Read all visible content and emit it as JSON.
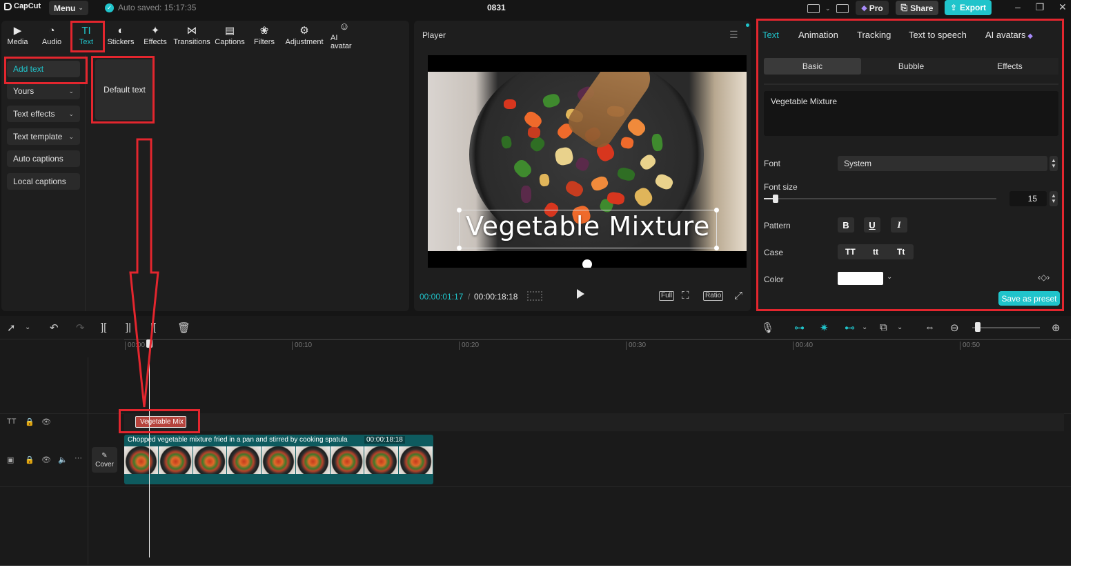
{
  "titlebar": {
    "app_name": "CapCut",
    "menu_label": "Menu",
    "autosave": "Auto saved: 15:17:35",
    "project_name": "0831",
    "pro_label": "Pro",
    "share_label": "Share",
    "export_label": "Export"
  },
  "top_tabs": [
    {
      "label": "Media",
      "icon": "media-icon"
    },
    {
      "label": "Audio",
      "icon": "audio-icon"
    },
    {
      "label": "Text",
      "icon": "text-icon",
      "active": true
    },
    {
      "label": "Stickers",
      "icon": "stickers-icon"
    },
    {
      "label": "Effects",
      "icon": "effects-icon"
    },
    {
      "label": "Transitions",
      "icon": "transitions-icon"
    },
    {
      "label": "Captions",
      "icon": "captions-icon"
    },
    {
      "label": "Filters",
      "icon": "filters-icon"
    },
    {
      "label": "Adjustment",
      "icon": "adjustment-icon"
    },
    {
      "label": "AI avatar",
      "icon": "ai-avatar-icon"
    }
  ],
  "side_nav": {
    "items": [
      {
        "label": "Add text",
        "active": true,
        "has_chevron": false
      },
      {
        "label": "Yours",
        "has_chevron": true
      },
      {
        "label": "Text effects",
        "has_chevron": true
      },
      {
        "label": "Text template",
        "has_chevron": true
      },
      {
        "label": "Auto captions",
        "has_chevron": false
      },
      {
        "label": "Local captions",
        "has_chevron": false
      }
    ]
  },
  "library": {
    "card_label": "Default text"
  },
  "player": {
    "title": "Player",
    "overlay_text": "Vegetable Mixture",
    "current_time": "00:00:01:17",
    "separator": "/",
    "total_time": "00:00:18:18",
    "full_label": "Full",
    "ratio_label": "Ratio"
  },
  "inspector": {
    "tabs": [
      "Text",
      "Animation",
      "Tracking",
      "Text to speech",
      "AI avatars"
    ],
    "active_tab": "Text",
    "sub_tabs": [
      "Basic",
      "Bubble",
      "Effects"
    ],
    "active_sub_tab": "Basic",
    "text_value": "Vegetable Mixture",
    "font_label": "Font",
    "font_value": "System",
    "font_size_label": "Font size",
    "font_size_value": "15",
    "font_size_slider_fraction": 0.05,
    "pattern_label": "Pattern",
    "pattern_buttons": [
      "B",
      "U",
      "I"
    ],
    "case_label": "Case",
    "case_buttons": [
      "TT",
      "tt",
      "Tt"
    ],
    "color_label": "Color",
    "color_value": "#ffffff",
    "save_preset_label": "Save as preset"
  },
  "timeline": {
    "ruler_ticks": [
      "00:00",
      "00:10",
      "00:20",
      "00:30",
      "00:40",
      "00:50"
    ],
    "text_clip_label": "Vegetable Mix",
    "cover_label": "Cover",
    "video_clip_label": "Chopped vegetable mixture fried in a pan and stirred by cooking spatula",
    "video_clip_duration": "00:00:18:18",
    "zoom_fraction": 0.08
  },
  "colors": {
    "accent": "#20c4cb",
    "annotation": "#e3262e",
    "background": "#151515",
    "panel": "#1e1e1e"
  }
}
